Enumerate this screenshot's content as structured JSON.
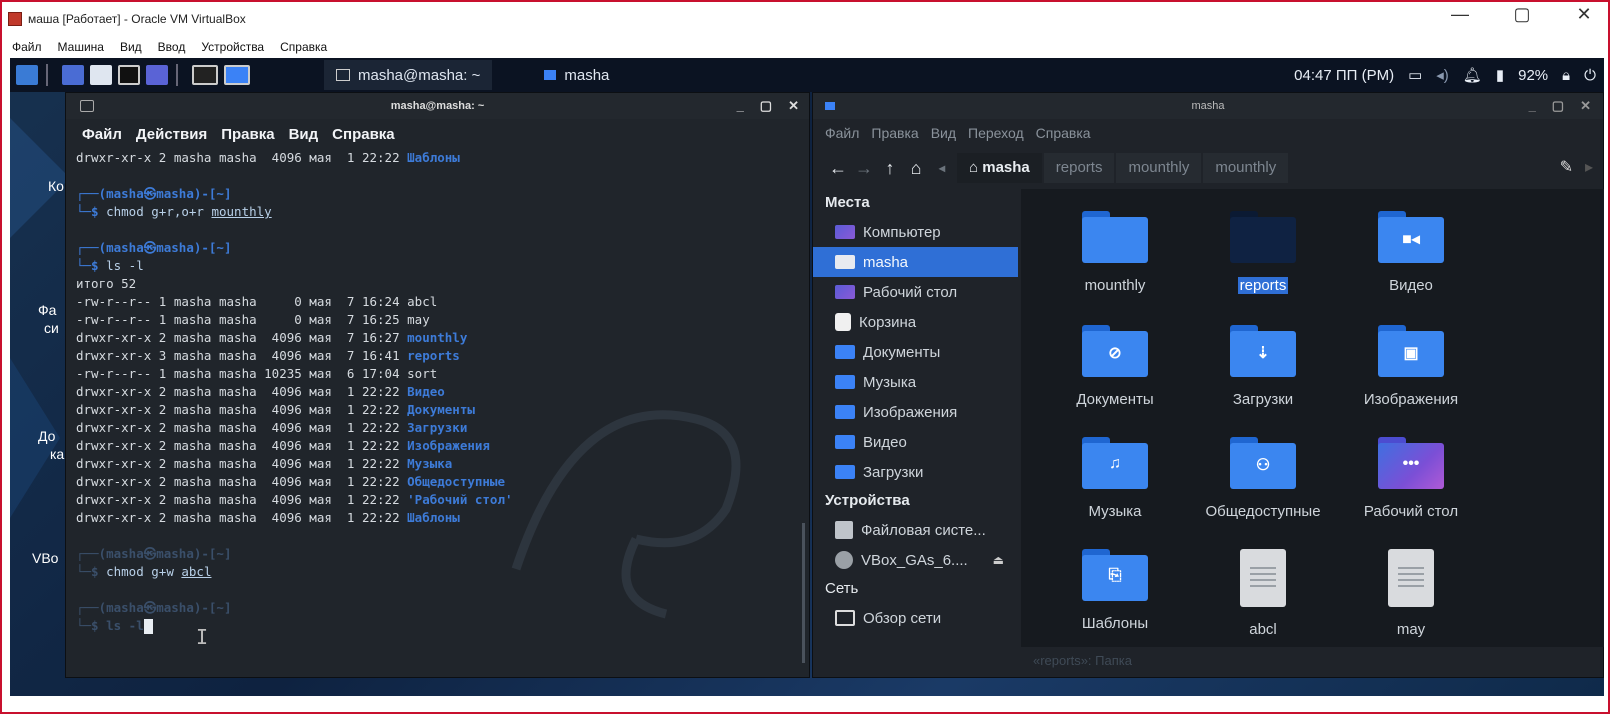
{
  "host": {
    "title": "маша [Работает] - Oracle VM VirtualBox",
    "menu": [
      "Файл",
      "Машина",
      "Вид",
      "Ввод",
      "Устройства",
      "Справка"
    ],
    "controls": {
      "minimize": "—",
      "maximize": "▢",
      "close": "✕"
    }
  },
  "panel": {
    "tasks": [
      {
        "label": "masha@masha: ~",
        "active": true
      },
      {
        "label": "masha",
        "active": false
      }
    ],
    "clock": "04:47 ПП (PM)",
    "battery": "92%"
  },
  "desktop_labels": [
    "Ко",
    "Фа",
    "си",
    "До",
    "ка",
    "VBo"
  ],
  "terminal": {
    "title": "masha@masha: ~",
    "controls": {
      "minimize": "_",
      "maximize": "▢",
      "close": "✕"
    },
    "menu": [
      "Файл",
      "Действия",
      "Правка",
      "Вид",
      "Справка"
    ],
    "top_line": {
      "perm": "drwxr-xr-x 2 masha masha  4096 мая  1 22:22 ",
      "name": "Шаблоны"
    },
    "prompt_head": "┌──(masha㉿masha)-[~]",
    "prompt_tail": "└─$ ",
    "cmd1": {
      "base": "chmod g+r,o+r ",
      "arg": "mounthly"
    },
    "cmd2": "ls -l",
    "total": "итого 52",
    "listing": [
      {
        "perm": "-rw-r--r-- 1 masha masha     0 мая  7 16:24 ",
        "name": "abcl",
        "dir": false
      },
      {
        "perm": "-rw-r--r-- 1 masha masha     0 мая  7 16:25 ",
        "name": "may",
        "dir": false
      },
      {
        "perm": "drwxr-xr-x 2 masha masha  4096 мая  7 16:27 ",
        "name": "mounthly",
        "dir": true
      },
      {
        "perm": "drwxr-xr-x 3 masha masha  4096 мая  7 16:41 ",
        "name": "reports",
        "dir": true
      },
      {
        "perm": "-rw-r--r-- 1 masha masha 10235 мая  6 17:04 ",
        "name": "sort",
        "dir": false
      },
      {
        "perm": "drwxr-xr-x 2 masha masha  4096 мая  1 22:22 ",
        "name": "Видео",
        "dir": true
      },
      {
        "perm": "drwxr-xr-x 2 masha masha  4096 мая  1 22:22 ",
        "name": "Документы",
        "dir": true
      },
      {
        "perm": "drwxr-xr-x 2 masha masha  4096 мая  1 22:22 ",
        "name": "Загрузки",
        "dir": true
      },
      {
        "perm": "drwxr-xr-x 2 masha masha  4096 мая  1 22:22 ",
        "name": "Изображения",
        "dir": true
      },
      {
        "perm": "drwxr-xr-x 2 masha masha  4096 мая  1 22:22 ",
        "name": "Музыка",
        "dir": true
      },
      {
        "perm": "drwxr-xr-x 2 masha masha  4096 мая  1 22:22 ",
        "name": "Общедоступные",
        "dir": true
      },
      {
        "perm": "drwxr-xr-x 2 masha masha  4096 мая  1 22:22 ",
        "name": "'Рабочий стол'",
        "dir": true
      },
      {
        "perm": "drwxr-xr-x 2 masha masha  4096 мая  1 22:22 ",
        "name": "Шаблоны",
        "dir": true
      }
    ],
    "cmd3": {
      "base": "chmod g+w ",
      "arg": "abcl"
    },
    "cmd4": "ls -l"
  },
  "filemanager": {
    "title": "masha",
    "controls": {
      "minimize": "_",
      "maximize": "▢",
      "close": "✕"
    },
    "menu": [
      "Файл",
      "Правка",
      "Вид",
      "Переход",
      "Справка"
    ],
    "breadcrumbs": [
      "masha",
      "reports",
      "mounthly",
      "mounthly"
    ],
    "sidebar": {
      "places_title": "Места",
      "places": [
        {
          "label": "Компьютер",
          "icon": "computer-icon"
        },
        {
          "label": "masha",
          "icon": "home-folder-icon",
          "selected": true
        },
        {
          "label": "Рабочий стол",
          "icon": "desktop-icon"
        },
        {
          "label": "Корзина",
          "icon": "trash-icon"
        },
        {
          "label": "Документы",
          "icon": "folder-icon"
        },
        {
          "label": "Музыка",
          "icon": "music-folder-icon"
        },
        {
          "label": "Изображения",
          "icon": "pictures-folder-icon"
        },
        {
          "label": "Видео",
          "icon": "video-folder-icon"
        },
        {
          "label": "Загрузки",
          "icon": "downloads-folder-icon"
        }
      ],
      "devices_title": "Устройства",
      "devices": [
        {
          "label": "Файловая систе...",
          "icon": "drive-icon"
        },
        {
          "label": "VBox_GAs_6....",
          "icon": "cdrom-icon"
        }
      ],
      "network_title": "Сеть",
      "network": [
        {
          "label": "Обзор сети",
          "icon": "network-icon"
        }
      ]
    },
    "items": [
      {
        "label": "mounthly",
        "kind": "folder",
        "glyph": ""
      },
      {
        "label": "reports",
        "kind": "folder-dark",
        "glyph": "",
        "selected": true
      },
      {
        "label": "Видео",
        "kind": "folder",
        "glyph": "■◂"
      },
      {
        "label": "Документы",
        "kind": "folder",
        "glyph": "⊘"
      },
      {
        "label": "Загрузки",
        "kind": "folder",
        "glyph": "⇣"
      },
      {
        "label": "Изображения",
        "kind": "folder",
        "glyph": "▣"
      },
      {
        "label": "Музыка",
        "kind": "folder",
        "glyph": "♫"
      },
      {
        "label": "Общедоступные",
        "kind": "folder",
        "glyph": "⚇"
      },
      {
        "label": "Рабочий стол",
        "kind": "folder-desk",
        "glyph": "•••"
      },
      {
        "label": "Шаблоны",
        "kind": "folder",
        "glyph": "⎘"
      },
      {
        "label": "abcl",
        "kind": "doc",
        "glyph": ""
      },
      {
        "label": "may",
        "kind": "doc",
        "glyph": ""
      }
    ],
    "status": "«reports»: Папка"
  },
  "colors": {
    "accent": "#2f6fd6",
    "folder": "#3b86f0",
    "prompt": "#3d7bd8",
    "host_border": "#c8102e"
  }
}
